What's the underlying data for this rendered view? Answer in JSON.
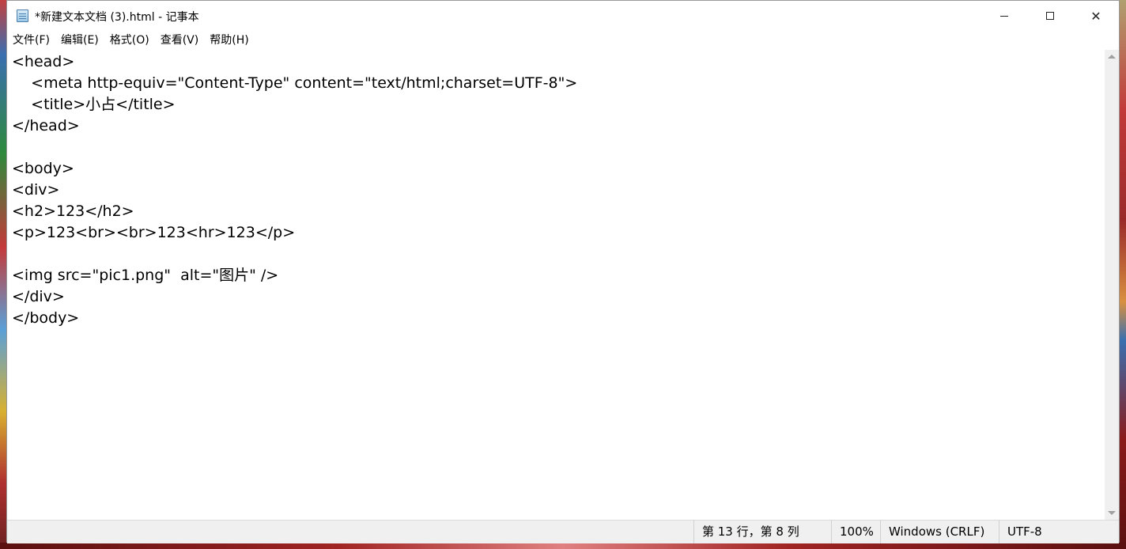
{
  "window": {
    "title": "*新建文本文档 (3).html - 记事本",
    "controls": {
      "minimize": "minimize",
      "maximize": "maximize",
      "close": "✕"
    }
  },
  "menu": {
    "items": [
      {
        "label": "文件(F)"
      },
      {
        "label": "编辑(E)"
      },
      {
        "label": "格式(O)"
      },
      {
        "label": "查看(V)"
      },
      {
        "label": "帮助(H)"
      }
    ]
  },
  "editor": {
    "content": "<head>\n    <meta http-equiv=\"Content-Type\" content=\"text/html;charset=UTF-8\">\n    <title>小占</title>\n</head>\n\n<body>\n<div>\n<h2>123</h2>\n<p>123<br><br>123<hr>123</p>\n\n<img src=\"pic1.png\"  alt=\"图片\" />\n</div>\n</body>"
  },
  "status": {
    "position": "第 13 行，第 8 列",
    "zoom": "100%",
    "line_ending": "Windows (CRLF)",
    "encoding": "UTF-8"
  },
  "colors": {
    "window_bg": "#ffffff",
    "statusbar_bg": "#f0f0f0",
    "desktop_accent": "#7a1a1a"
  }
}
